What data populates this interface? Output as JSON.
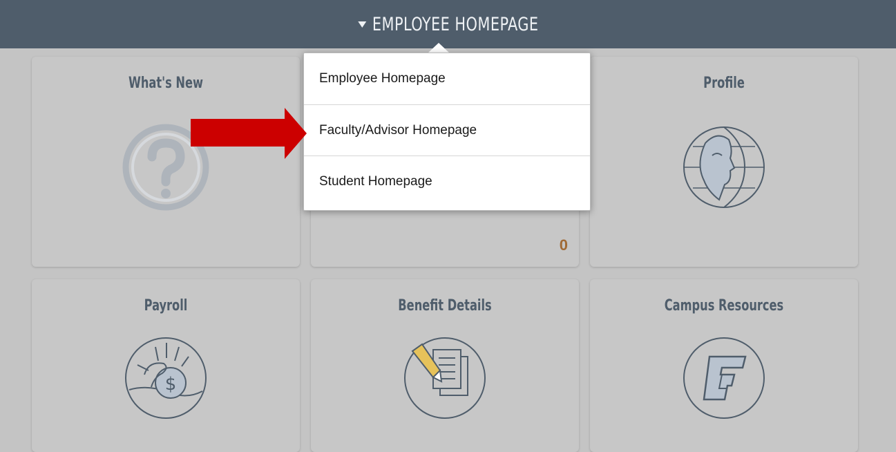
{
  "header": {
    "title": "EMPLOYEE HOMEPAGE"
  },
  "dropdown": {
    "items": [
      {
        "label": "Employee Homepage"
      },
      {
        "label": "Faculty/Advisor Homepage"
      },
      {
        "label": "Student Homepage"
      }
    ]
  },
  "tiles": {
    "whats_new": {
      "title": "What's New",
      "icon": "question-mark-icon"
    },
    "middle_top": {
      "count": "0"
    },
    "profile": {
      "title": "Profile",
      "icon": "profile-globe-icon"
    },
    "payroll": {
      "title": "Payroll",
      "icon": "payroll-coin-icon"
    },
    "benefit_details": {
      "title": "Benefit Details",
      "icon": "document-pencil-icon"
    },
    "campus_resources": {
      "title": "Campus Resources",
      "icon": "campus-logo-icon"
    }
  },
  "annotation": {
    "icon": "red-arrow-icon",
    "color": "#cc0000"
  },
  "colors": {
    "header": "#4f5d6b",
    "tile": "#c7c7c7",
    "tile_title": "#4f5d6b",
    "count": "#a06a35"
  }
}
